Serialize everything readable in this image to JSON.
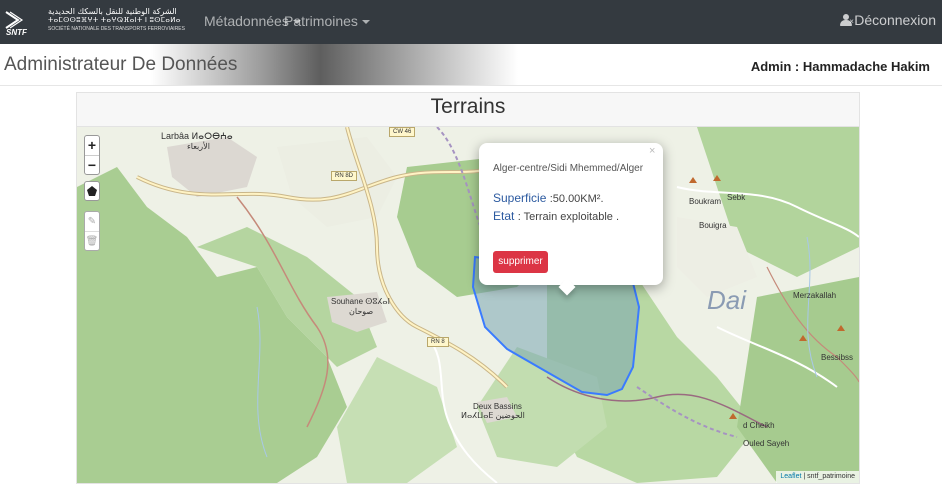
{
  "navbar": {
    "brand": {
      "arabic": "الشركة الوطنية للنقل بالسكك الحديدية",
      "tifinagh": "ⵜⴰⵎⵙⵙⵓⴼⵖⵜ ⵜⴰⵖⵕⴼⴰⵏⵜ ⵏ ⵓⵙⵎⴰⵍⴰ",
      "french": "SOCIÉTÉ NATIONALE DES TRANSPORTS FERROVIAIRES",
      "logo_text": "SNTF"
    },
    "menu": [
      {
        "label": "Métadonnées"
      },
      {
        "label": "Patrimoines"
      }
    ],
    "logout_label": "Déconnexion"
  },
  "header": {
    "title": "Administrateur De Données",
    "user": "Admin : Hammadache Hakim"
  },
  "card": {
    "title": "Terrains"
  },
  "map": {
    "zoom_in": "+",
    "zoom_out": "−",
    "labels": {
      "larbaa": "Larbâa ⵍⴰⵔⴱⵄⴰ",
      "larbaa_ar": "الأربعاء",
      "souhane": "Souhane ⵙⵓⵃⴰⵏ",
      "souhane_ar": "صوحان",
      "deux_bassins": "Deux Bassins",
      "deux_bassins_ar": "ⵍⴰⵃⵡⴰⴹ الحوضين",
      "boukram": "Boukram",
      "sebk": "Sebk",
      "bouigra": "Bouigra",
      "merzakallah": "Merzakallah",
      "bessibss": "Bessibss",
      "d_cheikh": "d Cheikh",
      "ouled_sayeh": "Ouled Sayeh",
      "dai": "Dai"
    },
    "roads": {
      "cw46": "CW 46",
      "rn8d": "RN 8D",
      "rn8": "RN 8"
    },
    "attribution_leaflet": "Leaflet",
    "attribution_source": "| sntf_patrimoine",
    "colors": {
      "polygon_stroke": "#3a7bff",
      "polygon_fill": "#7aa6b3"
    }
  },
  "popup": {
    "location": "Alger-centre/Sidi Mhemmed/Alger",
    "superficie_label": "Superficie",
    "superficie_value": ":50.00KM².",
    "etat_label": "Etat",
    "etat_value": ": Terrain exploitable .",
    "delete_label": "supprimer",
    "close": "×"
  }
}
